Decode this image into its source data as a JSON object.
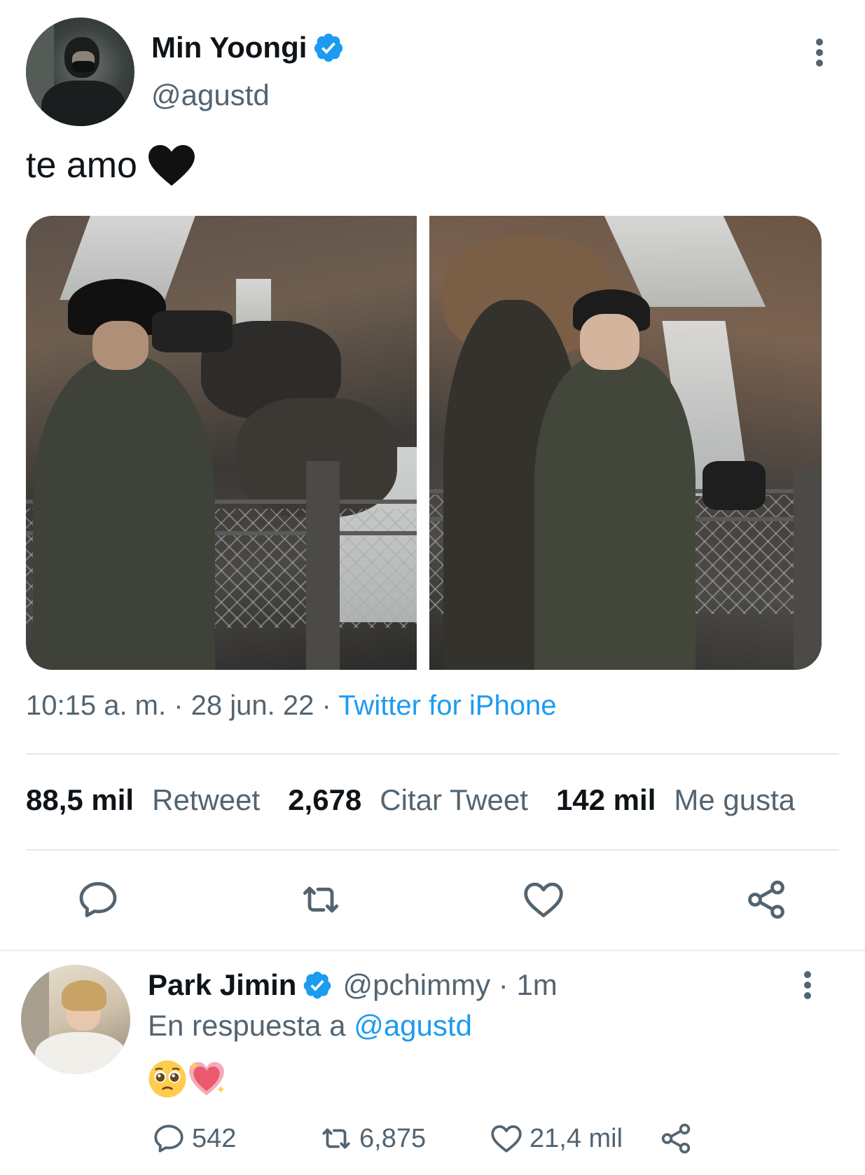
{
  "tweet": {
    "author_name": "Min Yoongi",
    "author_handle": "@agustd",
    "text": "te amo",
    "text_emoji": "black-heart",
    "time": "10:15 a. m.",
    "separator": " · ",
    "date": "28 jun. 22",
    "source": "Twitter for iPhone",
    "images": [
      "photo-taking-picture",
      "photo-hug-waterfall"
    ]
  },
  "stats": {
    "retweets_count": "88,5 mil",
    "retweets_label": "Retweet",
    "quotes_count": "2,678",
    "quotes_label": "Citar Tweet",
    "likes_count": "142 mil",
    "likes_label": "Me gusta"
  },
  "actions": [
    "reply-icon",
    "retweet-icon",
    "like-icon",
    "share-icon"
  ],
  "reply": {
    "author_name": "Park Jimin",
    "author_handle": "@pchimmy",
    "time_sep": " · ",
    "time": "1m",
    "reply_prefix": "En respuesta a ",
    "reply_mention": "@agustd",
    "emojis": [
      "pleading-face",
      "sparkling-heart"
    ],
    "replies_count": "542",
    "retweets_count": "6,875",
    "likes_count": "21,4 mil"
  },
  "colors": {
    "accent": "#1d9bf0",
    "text_primary": "#0f1419",
    "text_secondary": "#536471",
    "divider": "#e5e8eb"
  }
}
